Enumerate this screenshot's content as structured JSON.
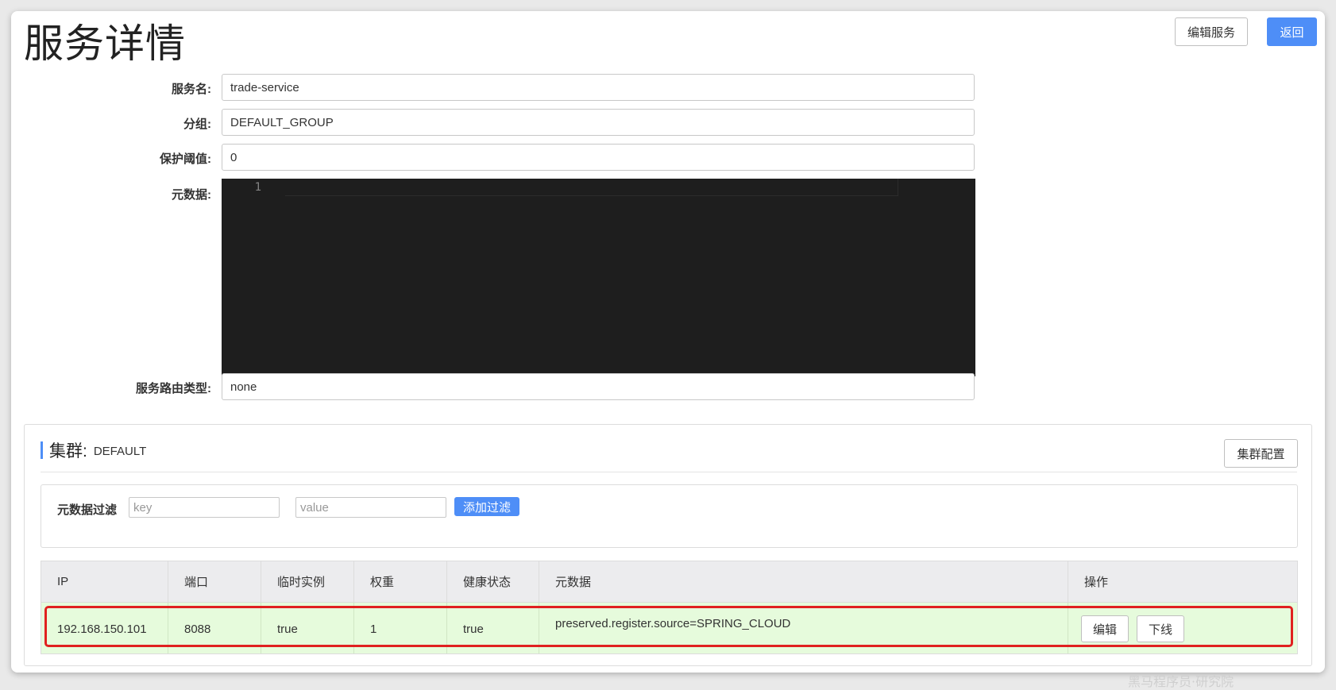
{
  "page": {
    "title": "服务详情",
    "edit_service_label": "编辑服务",
    "back_label": "返回"
  },
  "form": {
    "service_name": {
      "label": "服务名:",
      "value": "trade-service"
    },
    "group": {
      "label": "分组:",
      "value": "DEFAULT_GROUP"
    },
    "protect_threshold": {
      "label": "保护阈值:",
      "value": "0"
    },
    "metadata": {
      "label": "元数据:",
      "line_number": "1"
    },
    "route_type": {
      "label": "服务路由类型:",
      "value": "none"
    }
  },
  "cluster": {
    "title": "集群:",
    "name": "DEFAULT",
    "config_label": "集群配置",
    "filter": {
      "label": "元数据过滤",
      "key_placeholder": "key",
      "value_placeholder": "value",
      "add_label": "添加过滤"
    },
    "table": {
      "headers": [
        "IP",
        "端口",
        "临时实例",
        "权重",
        "健康状态",
        "元数据",
        "操作"
      ],
      "rows": [
        {
          "ip": "192.168.150.101",
          "port": "8088",
          "ephemeral": "true",
          "weight": "1",
          "healthy": "true",
          "metadata": "preserved.register.source=SPRING_CLOUD",
          "edit_label": "编辑",
          "offline_label": "下线"
        }
      ]
    }
  },
  "watermark": "黑马程序员·研究院",
  "colors": {
    "primary": "#4e8ef7",
    "row_background": "#e6fbdc",
    "highlight_border": "#e02020",
    "editor_background": "#1e1e1e"
  }
}
